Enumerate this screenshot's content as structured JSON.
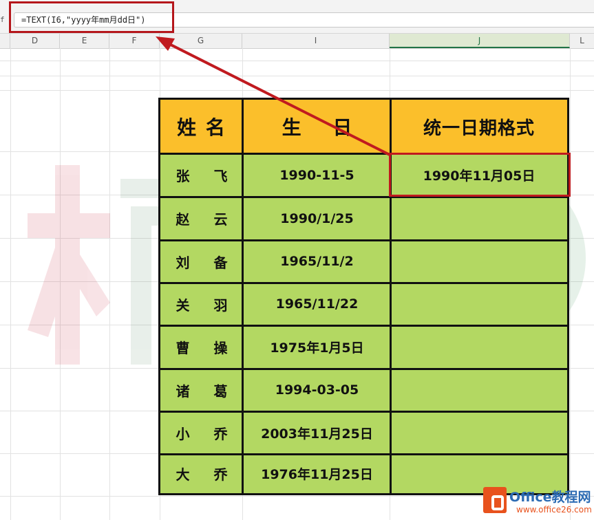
{
  "formula_bar": {
    "fx_label": "f",
    "formula": "=TEXT(I6,\"yyyy年mm月dd日\")"
  },
  "columns": [
    "D",
    "E",
    "F",
    "G",
    "I",
    "J",
    "L"
  ],
  "table": {
    "headers": {
      "name": "姓 名",
      "birthday": "生 日",
      "unified": "统一日期格式"
    },
    "rows": [
      {
        "name": "张 飞",
        "birthday": "1990-11-5",
        "unified": "1990年11月05日"
      },
      {
        "name": "赵 云",
        "birthday": "1990/1/25",
        "unified": ""
      },
      {
        "name": "刘 备",
        "birthday": "1965/11/2",
        "unified": ""
      },
      {
        "name": "关 羽",
        "birthday": "1965/11/22",
        "unified": ""
      },
      {
        "name": "曹 操",
        "birthday": "1975年1月5日",
        "unified": ""
      },
      {
        "name": "诸 葛",
        "birthday": "1994-03-05",
        "unified": ""
      },
      {
        "name": "小 乔",
        "birthday": "2003年11月25日",
        "unified": ""
      },
      {
        "name": "大 乔",
        "birthday": "1976年11月25日",
        "unified": ""
      }
    ]
  },
  "watermark": {
    "text": "楠GO"
  },
  "logo": {
    "title": "Office教程网",
    "url": "www.office26.com"
  },
  "colors": {
    "header_fill": "#fbbf2b",
    "body_fill": "#b3d862",
    "highlight": "#c01a1f",
    "active_column": "#217346"
  }
}
